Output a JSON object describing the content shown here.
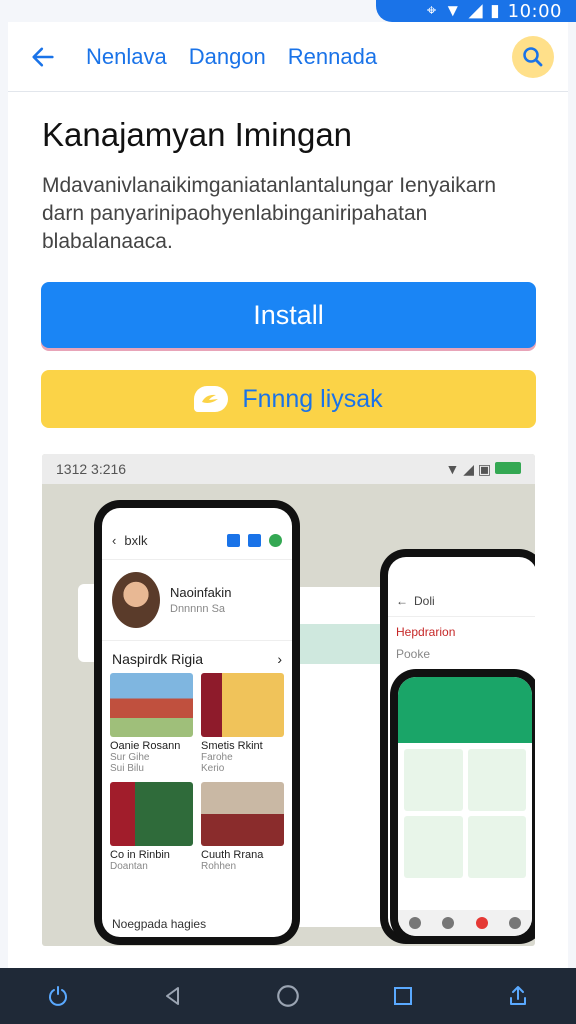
{
  "status_bar": {
    "time": "10:00"
  },
  "top_bar": {
    "tabs": [
      "Nenlava",
      "Dangon",
      "Rennada"
    ]
  },
  "app": {
    "title": "Kanajamyan Imingan",
    "description": "Mdavanivlanaikimganiatanlantalungar Ienyaikarn darn panyarinipaohyenlabinganiripahatan blabalanaaca."
  },
  "actions": {
    "install_label": "Install",
    "secondary_label": "Fnnng liysak"
  },
  "preview": {
    "status_time": "1312 3:216",
    "main_phone": {
      "bar_label": "bxlk",
      "profile_name": "Naoinfakin",
      "profile_sub": "Dnnnnn Sa",
      "section_title": "Naspirdk Rigia",
      "tiles": [
        {
          "title": "Oanie Rosann",
          "sub": "Sur Gihe",
          "extra": "Sui Bilu"
        },
        {
          "title": "Smetis Rkint",
          "sub": "Farohe",
          "extra": "Kerio"
        },
        {
          "title": "Co in Rinbin",
          "sub": "Doantan",
          "extra": ""
        },
        {
          "title": "Cuuth Rrana",
          "sub": "Rohhen",
          "extra": ""
        }
      ],
      "footer_label": "Noegpada hagies"
    },
    "right_phone": {
      "bar_label": "Doli",
      "app_label": "Hepdrarion",
      "app_sub": "Pooke"
    },
    "colors": {
      "accent": "#1a73e8",
      "install": "#1a85f5",
      "secondary": "#fbd347",
      "green": "#1aa568"
    }
  },
  "bottom_nav": {
    "icons": [
      "power-icon",
      "back-icon",
      "home-icon",
      "recents-icon",
      "share-icon"
    ]
  }
}
